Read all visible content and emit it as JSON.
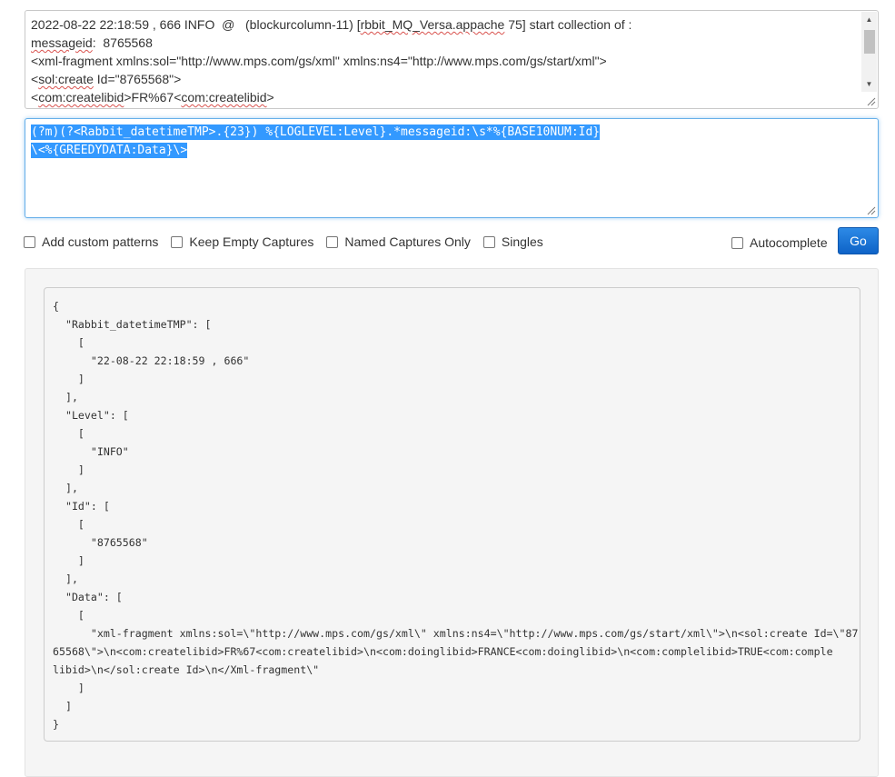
{
  "log_input": {
    "line1_pre": "2022-08-22 22:18:59 , 666 INFO  @   (blockurcolumn-11) [",
    "line1_spell": "rbbit_MQ_Versa.appache",
    "line1_post": " 75] start collection of :",
    "line2_spell": "messageid",
    "line2_post": ":  8765568",
    "line3": "<xml-fragment xmlns:sol=\"http://www.mps.com/gs/xml\" xmlns:ns4=\"http://www.mps.com/gs/start/xml\">",
    "line4_pre": "<",
    "line4_spell": "sol:create",
    "line4_post": " Id=\"8765568\">",
    "line5_pre": "<",
    "line5_spell1": "com:createlibid",
    "line5_mid": ">FR%67<",
    "line5_spell2": "com:createlibid",
    "line5_post": ">"
  },
  "pattern": {
    "line1": "(?m)(?<Rabbit_datetimeTMP>.{23}) %{LOGLEVEL:Level}.*messageid:\\s*%{BASE10NUM:Id}",
    "line2": "\\<%{GREEDYDATA:Data}\\>"
  },
  "options": {
    "add_custom_patterns": "Add custom patterns",
    "keep_empty_captures": "Keep Empty Captures",
    "named_captures_only": "Named Captures Only",
    "singles": "Singles",
    "autocomplete": "Autocomplete",
    "go": "Go"
  },
  "result": {
    "json_output": "{\n  \"Rabbit_datetimeTMP\": [\n    [\n      \"22-08-22 22:18:59 , 666\"\n    ]\n  ],\n  \"Level\": [\n    [\n      \"INFO\"\n    ]\n  ],\n  \"Id\": [\n    [\n      \"8765568\"\n    ]\n  ],\n  \"Data\": [\n    [\n      \"xml-fragment xmlns:sol=\\\"http://www.mps.com/gs/xml\\\" xmlns:ns4=\\\"http://www.mps.com/gs/start/xml\\\">\\n<sol:create Id=\\\"87\n65568\\\">\\n<com:createlibid>FR%67<com:createlibid>\\n<com:doinglibid>FRANCE<com:doinglibid>\\n<com:complelibid>TRUE<com:comple\nlibid>\\n</sol:create Id>\\n</Xml-fragment\\\"\n    ]\n  ]\n}"
  }
}
